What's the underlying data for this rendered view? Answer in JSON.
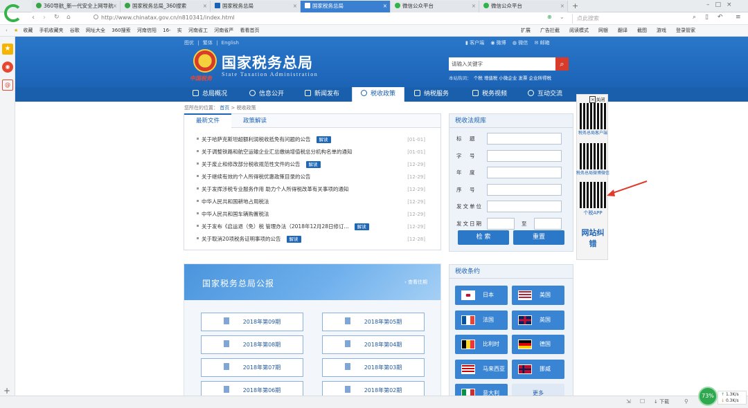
{
  "browser": {
    "tabs": [
      {
        "label": "360导航_新一代安全上网导航"
      },
      {
        "label": "国家税务总局_360搜索"
      },
      {
        "label": "国家税务总局"
      },
      {
        "label": "国家税务总局"
      },
      {
        "label": "微信公众平台"
      },
      {
        "label": "微信公众平台"
      }
    ],
    "url": "http://www.chinatax.gov.cn/n810341/index.html",
    "search_placeholder": "点此搜索",
    "bookmarks": [
      "收藏",
      "手机收藏夹",
      "谷歌",
      "网址大全",
      "360搜索",
      "河南信阳",
      "16-",
      "实",
      "河南省工",
      "河南省严",
      "看看首页"
    ],
    "toolbar_right": [
      "扩展",
      "广告拦截",
      "阅读模式",
      "网银",
      "翻译",
      "截图",
      "游戏",
      "登录管家"
    ],
    "status": {
      "percent": "73%",
      "up": "1.3K/s",
      "down": "0.3K/s",
      "download_label": "下载"
    }
  },
  "site": {
    "top_links": [
      "图优",
      "繁体",
      "English"
    ],
    "title_cn": "国家税务总局",
    "title_en": "State Taxation Administration",
    "logo_text": "中国税务",
    "quick_links": [
      "客户端",
      "微博",
      "微信",
      "邮箱"
    ],
    "search": {
      "placeholder": "请输入关键字",
      "hot_label": "本站热词：",
      "hot_words": "个税 增值税 小微企业 发票 企业所得税"
    },
    "nav": [
      "总局概况",
      "信息公开",
      "新闻发布",
      "税收政策",
      "纳税服务",
      "税务视频",
      "互动交流"
    ],
    "breadcrumb": {
      "prefix": "您所在的位置：",
      "home": "首页",
      "sep": ">",
      "current": "税收政策"
    },
    "tabs": [
      "最新文件",
      "政策解读"
    ],
    "news": [
      {
        "title": "关于哈萨克斯坦超额利润税收抵免有问题的公告",
        "badge": "解读",
        "date": "[01-01]"
      },
      {
        "title": "关于调整铁路和航空运输企业汇总缴纳增值税总分机构名单的通知",
        "badge": "",
        "date": "[01-01]"
      },
      {
        "title": "关于废止和修改部分税收规范性文件的公告",
        "badge": "解读",
        "date": "[12-29]"
      },
      {
        "title": "关于继续有效的个人所得税优惠政策目录的公告",
        "badge": "",
        "date": "[12-29]"
      },
      {
        "title": "关于发挥涉税专业服务作用 助力个人所得税改革有关事项的通知",
        "badge": "",
        "date": "[12-29]"
      },
      {
        "title": "中华人民共和国耕地占用税法",
        "badge": "",
        "date": "[12-29]"
      },
      {
        "title": "中华人民共和国车辆购置税法",
        "badge": "",
        "date": "[12-29]"
      },
      {
        "title": "关于发布《启运退（免）税 管理办法（2018年12月28日修订...",
        "badge": "解读",
        "date": "[12-29]"
      },
      {
        "title": "关于取消20项税务证明事项的公告",
        "badge": "解读",
        "date": "[12-28]"
      }
    ],
    "gazette": {
      "title": "国家税务总局公报",
      "more": "查看往期"
    },
    "issues": [
      "2018年第09期",
      "2018年第05期",
      "2018年第08期",
      "2018年第04期",
      "2018年第07期",
      "2018年第03期",
      "2018年第06期",
      "2018年第02期"
    ],
    "law_panel": {
      "title": "税收法规库",
      "fields": [
        "标　题",
        "字　号",
        "年　度",
        "序　号",
        "发文单位",
        "发文日期"
      ],
      "to": "至",
      "search_btn": "检 索",
      "reset_btn": "重置"
    },
    "treaty_panel": {
      "title": "税收条约",
      "countries": [
        "日本",
        "美国",
        "法国",
        "英国",
        "比利时",
        "德国",
        "马来西亚",
        "挪威",
        "意大利",
        "更多"
      ]
    },
    "float": {
      "close": "关闭",
      "qr1": "税务总局客户端",
      "qr2": "税务总局微博微信",
      "qr3": "个税APP",
      "wrong": "网站纠错"
    }
  },
  "colors": {
    "brand_blue": "#1d63b5",
    "nav_blue": "#1a5fab",
    "accent_red": "#d93b2b"
  }
}
